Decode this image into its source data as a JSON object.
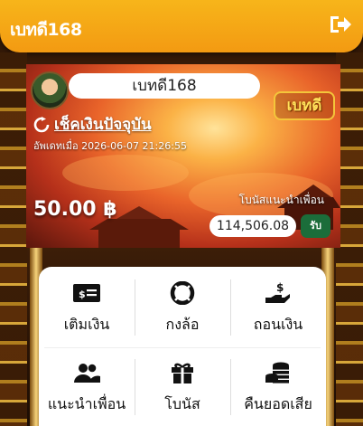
{
  "header": {
    "brand": "เบทดี168",
    "logout_icon": "sign-out-icon"
  },
  "card": {
    "username": "เบทดี168",
    "refresh_label": "เช็คเงินปัจจุบัน",
    "updated_label": "อัพเดทเมื่อ 2026-06-07 21:26:55",
    "logo_text": "เบทดี",
    "balance": "50.00 ฿",
    "bonus_label": "โบนัสแนะนำเพื่อน",
    "bonus_value": "114,506.08",
    "claim_label": "รับ"
  },
  "menu": {
    "items": [
      {
        "label": "เติมเงิน",
        "icon": "money-bill-icon"
      },
      {
        "label": "กงล้อ",
        "icon": "life-ring-wheel-icon"
      },
      {
        "label": "ถอนเงิน",
        "icon": "hand-dollar-icon"
      },
      {
        "label": "แนะนำเพื่อน",
        "icon": "users-icon"
      },
      {
        "label": "โบนัส",
        "icon": "gift-icon"
      },
      {
        "label": "คืนยอดเสีย",
        "icon": "coins-icon"
      }
    ]
  },
  "colors": {
    "header": "#f4a414",
    "claim": "#1b6d3a",
    "icon": "#111111"
  }
}
